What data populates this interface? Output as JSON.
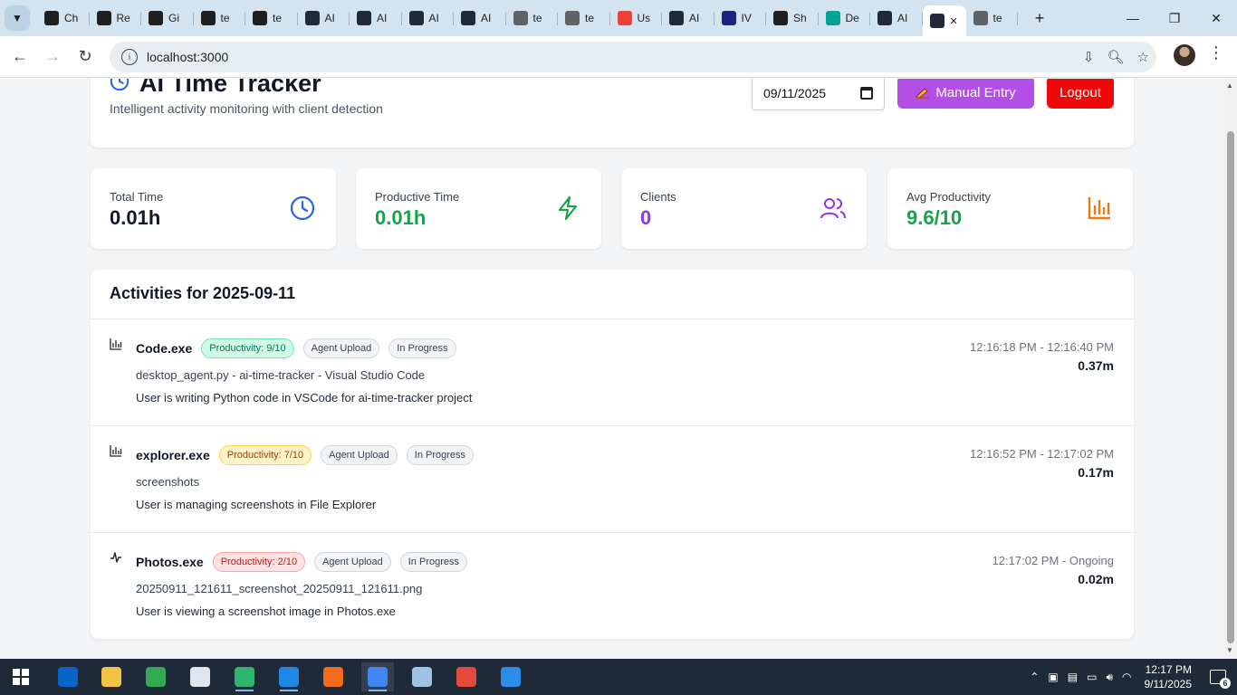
{
  "browser": {
    "tabs": [
      {
        "label": "Ch",
        "icon": "openai-icon",
        "color": "#1f1f1f"
      },
      {
        "label": "Re",
        "icon": "replit-icon",
        "color": "#1f1f1f"
      },
      {
        "label": "Gi",
        "icon": "openai-icon",
        "color": "#1f1f1f"
      },
      {
        "label": "te",
        "icon": "github-icon",
        "color": "#1f1f1f"
      },
      {
        "label": "te",
        "icon": "replit-icon",
        "color": "#1f1f1f"
      },
      {
        "label": "AI",
        "icon": "react-icon",
        "color": "#1f2937"
      },
      {
        "label": "AI",
        "icon": "react-icon",
        "color": "#1f2937"
      },
      {
        "label": "AI",
        "icon": "react-icon",
        "color": "#1f2937"
      },
      {
        "label": "AI",
        "icon": "react-icon",
        "color": "#1f2937"
      },
      {
        "label": "te",
        "icon": "globe-icon",
        "color": "#5f6368"
      },
      {
        "label": "te",
        "icon": "globe-icon",
        "color": "#5f6368"
      },
      {
        "label": "Us",
        "icon": "notification-9-icon",
        "color": "#ea4335"
      },
      {
        "label": "AI",
        "icon": "react-icon",
        "color": "#1f2937"
      },
      {
        "label": "IV",
        "icon": "ivy-icon",
        "color": "#1a237e"
      },
      {
        "label": "Sh",
        "icon": "github-icon",
        "color": "#1f1f1f"
      },
      {
        "label": "De",
        "icon": "deepseek-icon",
        "color": "#00a693"
      },
      {
        "label": "AI",
        "icon": "react-icon",
        "color": "#1f2937"
      }
    ],
    "active_tab_icon": "react-icon",
    "last_tab": {
      "label": "te",
      "icon": "globe-icon"
    },
    "url": "localhost:3000"
  },
  "app": {
    "title": "AI Time Tracker",
    "subtitle": "Intelligent activity monitoring with client detection",
    "date_value": "09/11/2025",
    "manual_entry_label": "Manual Entry",
    "logout_label": "Logout",
    "colors": {
      "manual": "#b34fe7",
      "logout": "#ee0a0a",
      "accent_blue": "#2563eb"
    }
  },
  "stats": [
    {
      "label": "Total Time",
      "value": "0.01h",
      "color": "#111827",
      "icon": "clock-icon"
    },
    {
      "label": "Productive Time",
      "value": "0.01h",
      "color": "#16a34a",
      "icon": "lightning-icon"
    },
    {
      "label": "Clients",
      "value": "0",
      "color": "#9333ea",
      "icon": "users-icon"
    },
    {
      "label": "Avg Productivity",
      "value": "9.6/10",
      "color": "#16a34a",
      "icon": "bar-chart-icon"
    }
  ],
  "activities": {
    "title": "Activities for 2025-09-11",
    "items": [
      {
        "icon": "bar-chart-icon",
        "name": "Code.exe",
        "productivity": "Productivity: 9/10",
        "productivity_level": "high",
        "source": "Agent Upload",
        "status": "In Progress",
        "window": "desktop_agent.py - ai-time-tracker - Visual Studio Code",
        "description": "User is writing Python code in VSCode for ai-time-tracker project",
        "time": "12:16:18 PM - 12:16:40 PM",
        "duration": "0.37m"
      },
      {
        "icon": "bar-chart-icon",
        "name": "explorer.exe",
        "productivity": "Productivity: 7/10",
        "productivity_level": "medium",
        "source": "Agent Upload",
        "status": "In Progress",
        "window": "screenshots",
        "description": "User is managing screenshots in File Explorer",
        "time": "12:16:52 PM - 12:17:02 PM",
        "duration": "0.17m"
      },
      {
        "icon": "activity-pulse-icon",
        "name": "Photos.exe",
        "productivity": "Productivity: 2/10",
        "productivity_level": "low",
        "source": "Agent Upload",
        "status": "In Progress",
        "window": "20250911_121611_screenshot_20250911_121611.png",
        "description": "User is viewing a screenshot image in Photos.exe",
        "time": "12:17:02 PM - Ongoing",
        "duration": "0.02m"
      }
    ]
  },
  "taskbar": {
    "apps": [
      {
        "name": "outlook-icon",
        "color": "#0a64c8"
      },
      {
        "name": "file-explorer-icon",
        "color": "#f2c243"
      },
      {
        "name": "chrome-icon",
        "color": "#34a853"
      },
      {
        "name": "notepad-icon",
        "color": "#dfe6ef"
      },
      {
        "name": "checkmark-app-icon",
        "color": "#2fb56f"
      },
      {
        "name": "vscode-icon",
        "color": "#1e88e5"
      },
      {
        "name": "orange-app-icon",
        "color": "#f26a1b"
      },
      {
        "name": "chrome-profile-icon",
        "color": "#4285f4"
      },
      {
        "name": "notes-app-icon",
        "color": "#9fc3e0"
      },
      {
        "name": "snipping-tool-icon",
        "color": "#e24a3b"
      },
      {
        "name": "photos-icon",
        "color": "#2b8de8"
      }
    ],
    "time": "12:17 PM",
    "date": "9/11/2025",
    "notification_count": "6"
  }
}
